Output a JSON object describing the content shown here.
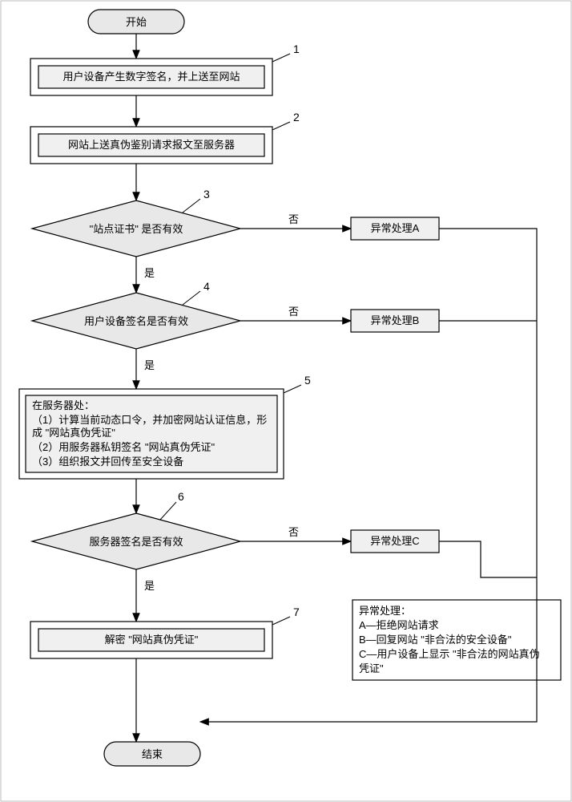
{
  "chart_data": {
    "type": "flowchart",
    "nodes": [
      {
        "id": "start",
        "type": "terminator",
        "text": "开始"
      },
      {
        "id": "n1",
        "type": "process",
        "label": "1",
        "text": "用户设备产生数字签名，并上送至网站"
      },
      {
        "id": "n2",
        "type": "process",
        "label": "2",
        "text": "网站上送真伪鉴别请求报文至服务器"
      },
      {
        "id": "n3",
        "type": "decision",
        "label": "3",
        "text": "\"站点证书\" 是否有效",
        "yes": "是",
        "no": "否"
      },
      {
        "id": "exA",
        "type": "process",
        "text": "异常处理A"
      },
      {
        "id": "n4",
        "type": "decision",
        "label": "4",
        "text": "用户设备签名是否有效",
        "yes": "是",
        "no": "否"
      },
      {
        "id": "exB",
        "type": "process",
        "text": "异常处理B"
      },
      {
        "id": "n5",
        "type": "process",
        "label": "5",
        "text": "在服务器处：\n（1）计算当前动态口令，并加密网站认证信息，形成 \"网站真伪凭证\"\n（2）用服务器私钥签名 \"网站真伪凭证\"\n（3）组织报文并回传至安全设备"
      },
      {
        "id": "n6",
        "type": "decision",
        "label": "6",
        "text": "服务器签名是否有效",
        "yes": "是",
        "no": "否"
      },
      {
        "id": "exC",
        "type": "process",
        "text": "异常处理C"
      },
      {
        "id": "n7",
        "type": "process",
        "label": "7",
        "text": "解密 \"网站真伪凭证\""
      },
      {
        "id": "legend",
        "type": "note",
        "text": "异常处理：\nA—拒绝网站请求\nB—回复网站 \"非合法的安全设备\"\nC—用户设备上显示 \"非合法的网站真伪凭证\""
      },
      {
        "id": "end",
        "type": "terminator",
        "text": "结束"
      }
    ],
    "edges": [
      {
        "from": "start",
        "to": "n1"
      },
      {
        "from": "n1",
        "to": "n2"
      },
      {
        "from": "n2",
        "to": "n3"
      },
      {
        "from": "n3",
        "to": "n4",
        "label": "是"
      },
      {
        "from": "n3",
        "to": "exA",
        "label": "否"
      },
      {
        "from": "n4",
        "to": "n5",
        "label": "是"
      },
      {
        "from": "n4",
        "to": "exB",
        "label": "否"
      },
      {
        "from": "n5",
        "to": "n6"
      },
      {
        "from": "n6",
        "to": "n7",
        "label": "是"
      },
      {
        "from": "n6",
        "to": "exC",
        "label": "否"
      },
      {
        "from": "n7",
        "to": "end"
      },
      {
        "from": "exA",
        "to": "end"
      },
      {
        "from": "exB",
        "to": "end"
      },
      {
        "from": "exC",
        "to": "end"
      }
    ]
  },
  "start": "开始",
  "end": "结束",
  "n1_text": "用户设备产生数字签名，并上送至网站",
  "n2_text": "网站上送真伪鉴别请求报文至服务器",
  "n3_text": "\"站点证书\" 是否有效",
  "n4_text": "用户设备签名是否有效",
  "n5_l0": "在服务器处：",
  "n5_l1": "（1）计算当前动态口令，并加密网站认证信息，形",
  "n5_l1b": "成 \"网站真伪凭证\"",
  "n5_l2": "（2）用服务器私钥签名 \"网站真伪凭证\"",
  "n5_l3": "（3）组织报文并回传至安全设备",
  "n6_text": "服务器签名是否有效",
  "n7_text": "解密 \"网站真伪凭证\"",
  "exA": "异常处理A",
  "exB": "异常处理B",
  "exC": "异常处理C",
  "legend_t": "异常处理：",
  "legend_a": "A—拒绝网站请求",
  "legend_b": "B—回复网站 \"非合法的安全设备\"",
  "legend_c1": "C—用户设备上显示 \"非合法的网站真伪",
  "legend_c2": "凭证\"",
  "yes": "是",
  "no": "否",
  "num1": "1",
  "num2": "2",
  "num3": "3",
  "num4": "4",
  "num5": "5",
  "num6": "6",
  "num7": "7"
}
